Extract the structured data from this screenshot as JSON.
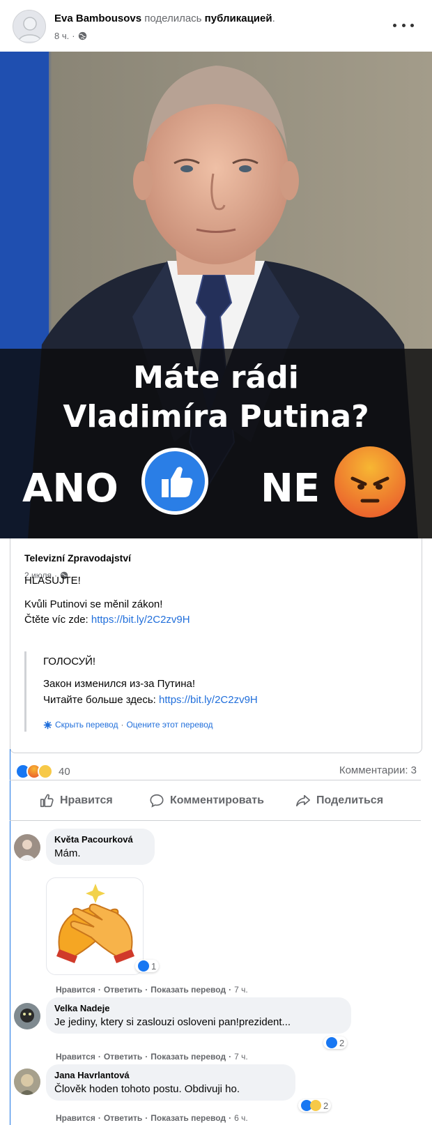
{
  "post": {
    "author": "Eva Bambousovs",
    "action": "поделилась",
    "object": "публикацией",
    "period": ".",
    "time": "8 ч."
  },
  "image": {
    "title_line1": "Máte rádi",
    "title_line2": "Vladimíra Putina?",
    "yes_label": "ANO",
    "no_label": "NE"
  },
  "shared": {
    "page_name": "Televizní Zpravodajství",
    "date": "2 июля",
    "line1": "HLASUJTE!",
    "line2": "Kvůli Putinovi se měnil zákon!",
    "line3_prefix": "Čtěte víc zde: ",
    "link": "https://bit.ly/2C2zv9H",
    "translation": {
      "line1": "ГОЛОСУЙ!",
      "line2": "Закон изменился из-за Путина!",
      "line3_prefix": "Читайте больше здесь: ",
      "link": "https://bit.ly/2C2zv9H",
      "hide": "Скрыть перевод",
      "sep": "·",
      "rate": "Оцените этот перевод"
    }
  },
  "stats": {
    "reaction_count": "40",
    "comments": "Комментарии: 3"
  },
  "actions": {
    "like": "Нравится",
    "comment": "Комментировать",
    "share": "Поделиться"
  },
  "comments": [
    {
      "name": "Květa Pacourková",
      "text": "Mám.",
      "reactions": "1",
      "like": "Нравится",
      "reply": "Ответить",
      "translate": "Показать перевод",
      "time": "7 ч."
    },
    {
      "name": "Velka Nadeje",
      "text": "Je jediny, ktery si zaslouzi osloveni pan!prezident...",
      "reactions": "2",
      "like": "Нравится",
      "reply": "Ответить",
      "translate": "Показать перевод",
      "time": "7 ч."
    },
    {
      "name": "Jana Havrlantová",
      "text": "Člověk hoden tohoto postu. Obdivuji ho.",
      "reactions": "2",
      "like": "Нравится",
      "reply": "Ответить",
      "translate": "Показать перевод",
      "time": "6 ч."
    }
  ],
  "colors": {
    "link": "#216fdb",
    "like_blue": "#1877f2",
    "muted": "#65676b"
  },
  "icons": {
    "privacy": "globe-icon",
    "menu": "more-dots-icon",
    "like": "thumbs-up-icon",
    "comment": "comment-bubble-icon",
    "share": "share-arrow-icon",
    "translate": "gear-icon"
  }
}
